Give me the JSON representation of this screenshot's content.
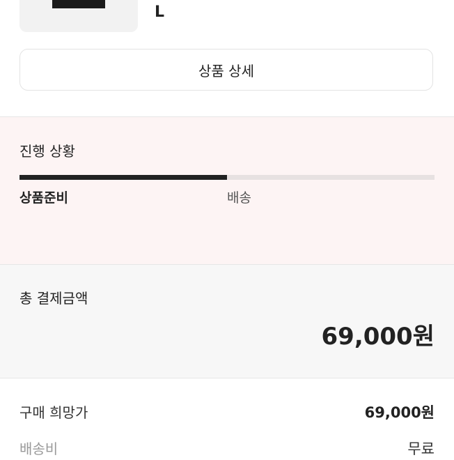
{
  "product": {
    "size": "L",
    "detail_button_label": "상품 상세"
  },
  "progress": {
    "title": "진행 상황",
    "percent": 50,
    "steps": [
      {
        "label": "상품준비",
        "active": true
      },
      {
        "label": "배송",
        "active": false
      }
    ]
  },
  "total": {
    "label": "총 결제금액",
    "amount": "69,000원"
  },
  "breakdown": [
    {
      "label": "구매 희망가",
      "value": "69,000원"
    },
    {
      "label": "배송비",
      "value": "무료"
    }
  ],
  "colors": {
    "progress_background": "#fdf4f4",
    "progress_fill": "#222222",
    "progress_track": "#e7e1e1",
    "total_background": "#f7f7f7"
  }
}
